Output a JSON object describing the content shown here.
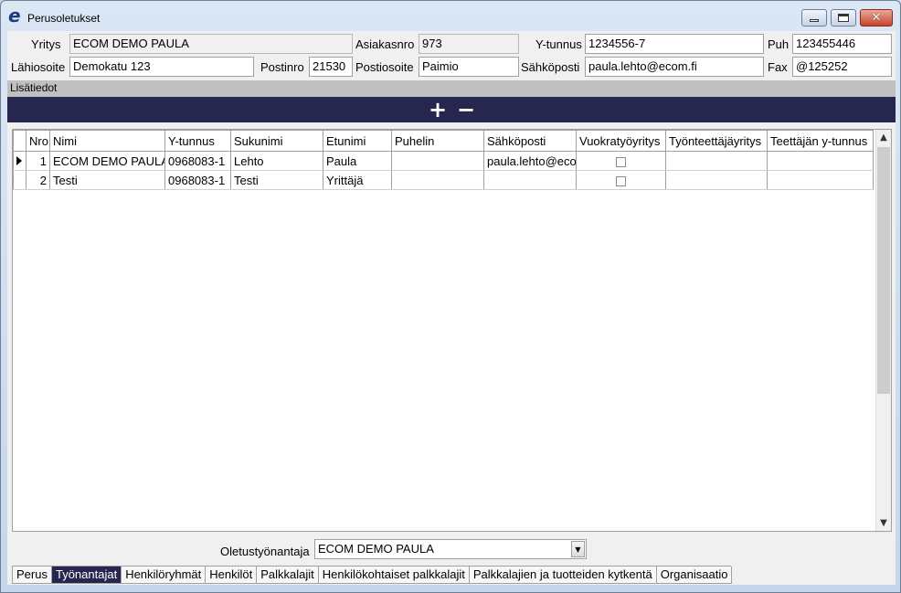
{
  "window": {
    "title": "Perusoletukset"
  },
  "form": {
    "yritys_label": "Yritys",
    "yritys_value": "ECOM DEMO PAULA",
    "asiakasnro_label": "Asiakasnro",
    "asiakasnro_value": "973",
    "ytunnus_label": "Y-tunnus",
    "ytunnus_value": "1234556-7",
    "puh_label": "Puh",
    "puh_value": "123455446",
    "lahiosoite_label": "Lähiosoite",
    "lahiosoite_value": "Demokatu 123",
    "postinro_label": "Postinro",
    "postinro_value": "21530",
    "postiosoite_label": "Postiosoite",
    "postiosoite_value": "Paimio",
    "sahkoposti_label": "Sähköposti",
    "sahkoposti_value": "paula.lehto@ecom.fi",
    "fax_label": "Fax",
    "fax_value": "@125252"
  },
  "section": {
    "title": "Lisätiedot",
    "add_label": "+",
    "remove_label": "−"
  },
  "grid": {
    "columns": [
      "Nro",
      "Nimi",
      "Y-tunnus",
      "Sukunimi",
      "Etunimi",
      "Puhelin",
      "Sähköposti",
      "Vuokratyöyritys",
      "Työnteettäjäyritys",
      "Teettäjän y-tunnus"
    ],
    "rows": [
      {
        "nro": "1",
        "nimi": "ECOM DEMO PAULA",
        "ytunnus": "0968083-1",
        "sukunimi": "Lehto",
        "etunimi": "Paula",
        "puhelin": "",
        "sahkoposti": "paula.lehto@ecom.fi",
        "vuokra": false,
        "tyonteettaja": "",
        "teettajan": ""
      },
      {
        "nro": "2",
        "nimi": "Testi",
        "ytunnus": "0968083-1",
        "sukunimi": "Testi",
        "etunimi": "Yrittäjä",
        "puhelin": "",
        "sahkoposti": "",
        "vuokra": false,
        "tyonteettaja": "",
        "teettajan": ""
      }
    ]
  },
  "footer": {
    "default_employer_label": "Oletustyönantaja",
    "default_employer_value": "ECOM DEMO PAULA"
  },
  "tabs": [
    "Perus",
    "Työnantajat",
    "Henkilöryhmät",
    "Henkilöt",
    "Palkkalajit",
    "Henkilökohtaiset palkkalajit",
    "Palkkalajien ja tuotteiden kytkentä",
    "Organisaatio"
  ],
  "active_tab": "Työnantajat",
  "colors": {
    "accent": "#26264f",
    "window": "#c9d9ec"
  }
}
